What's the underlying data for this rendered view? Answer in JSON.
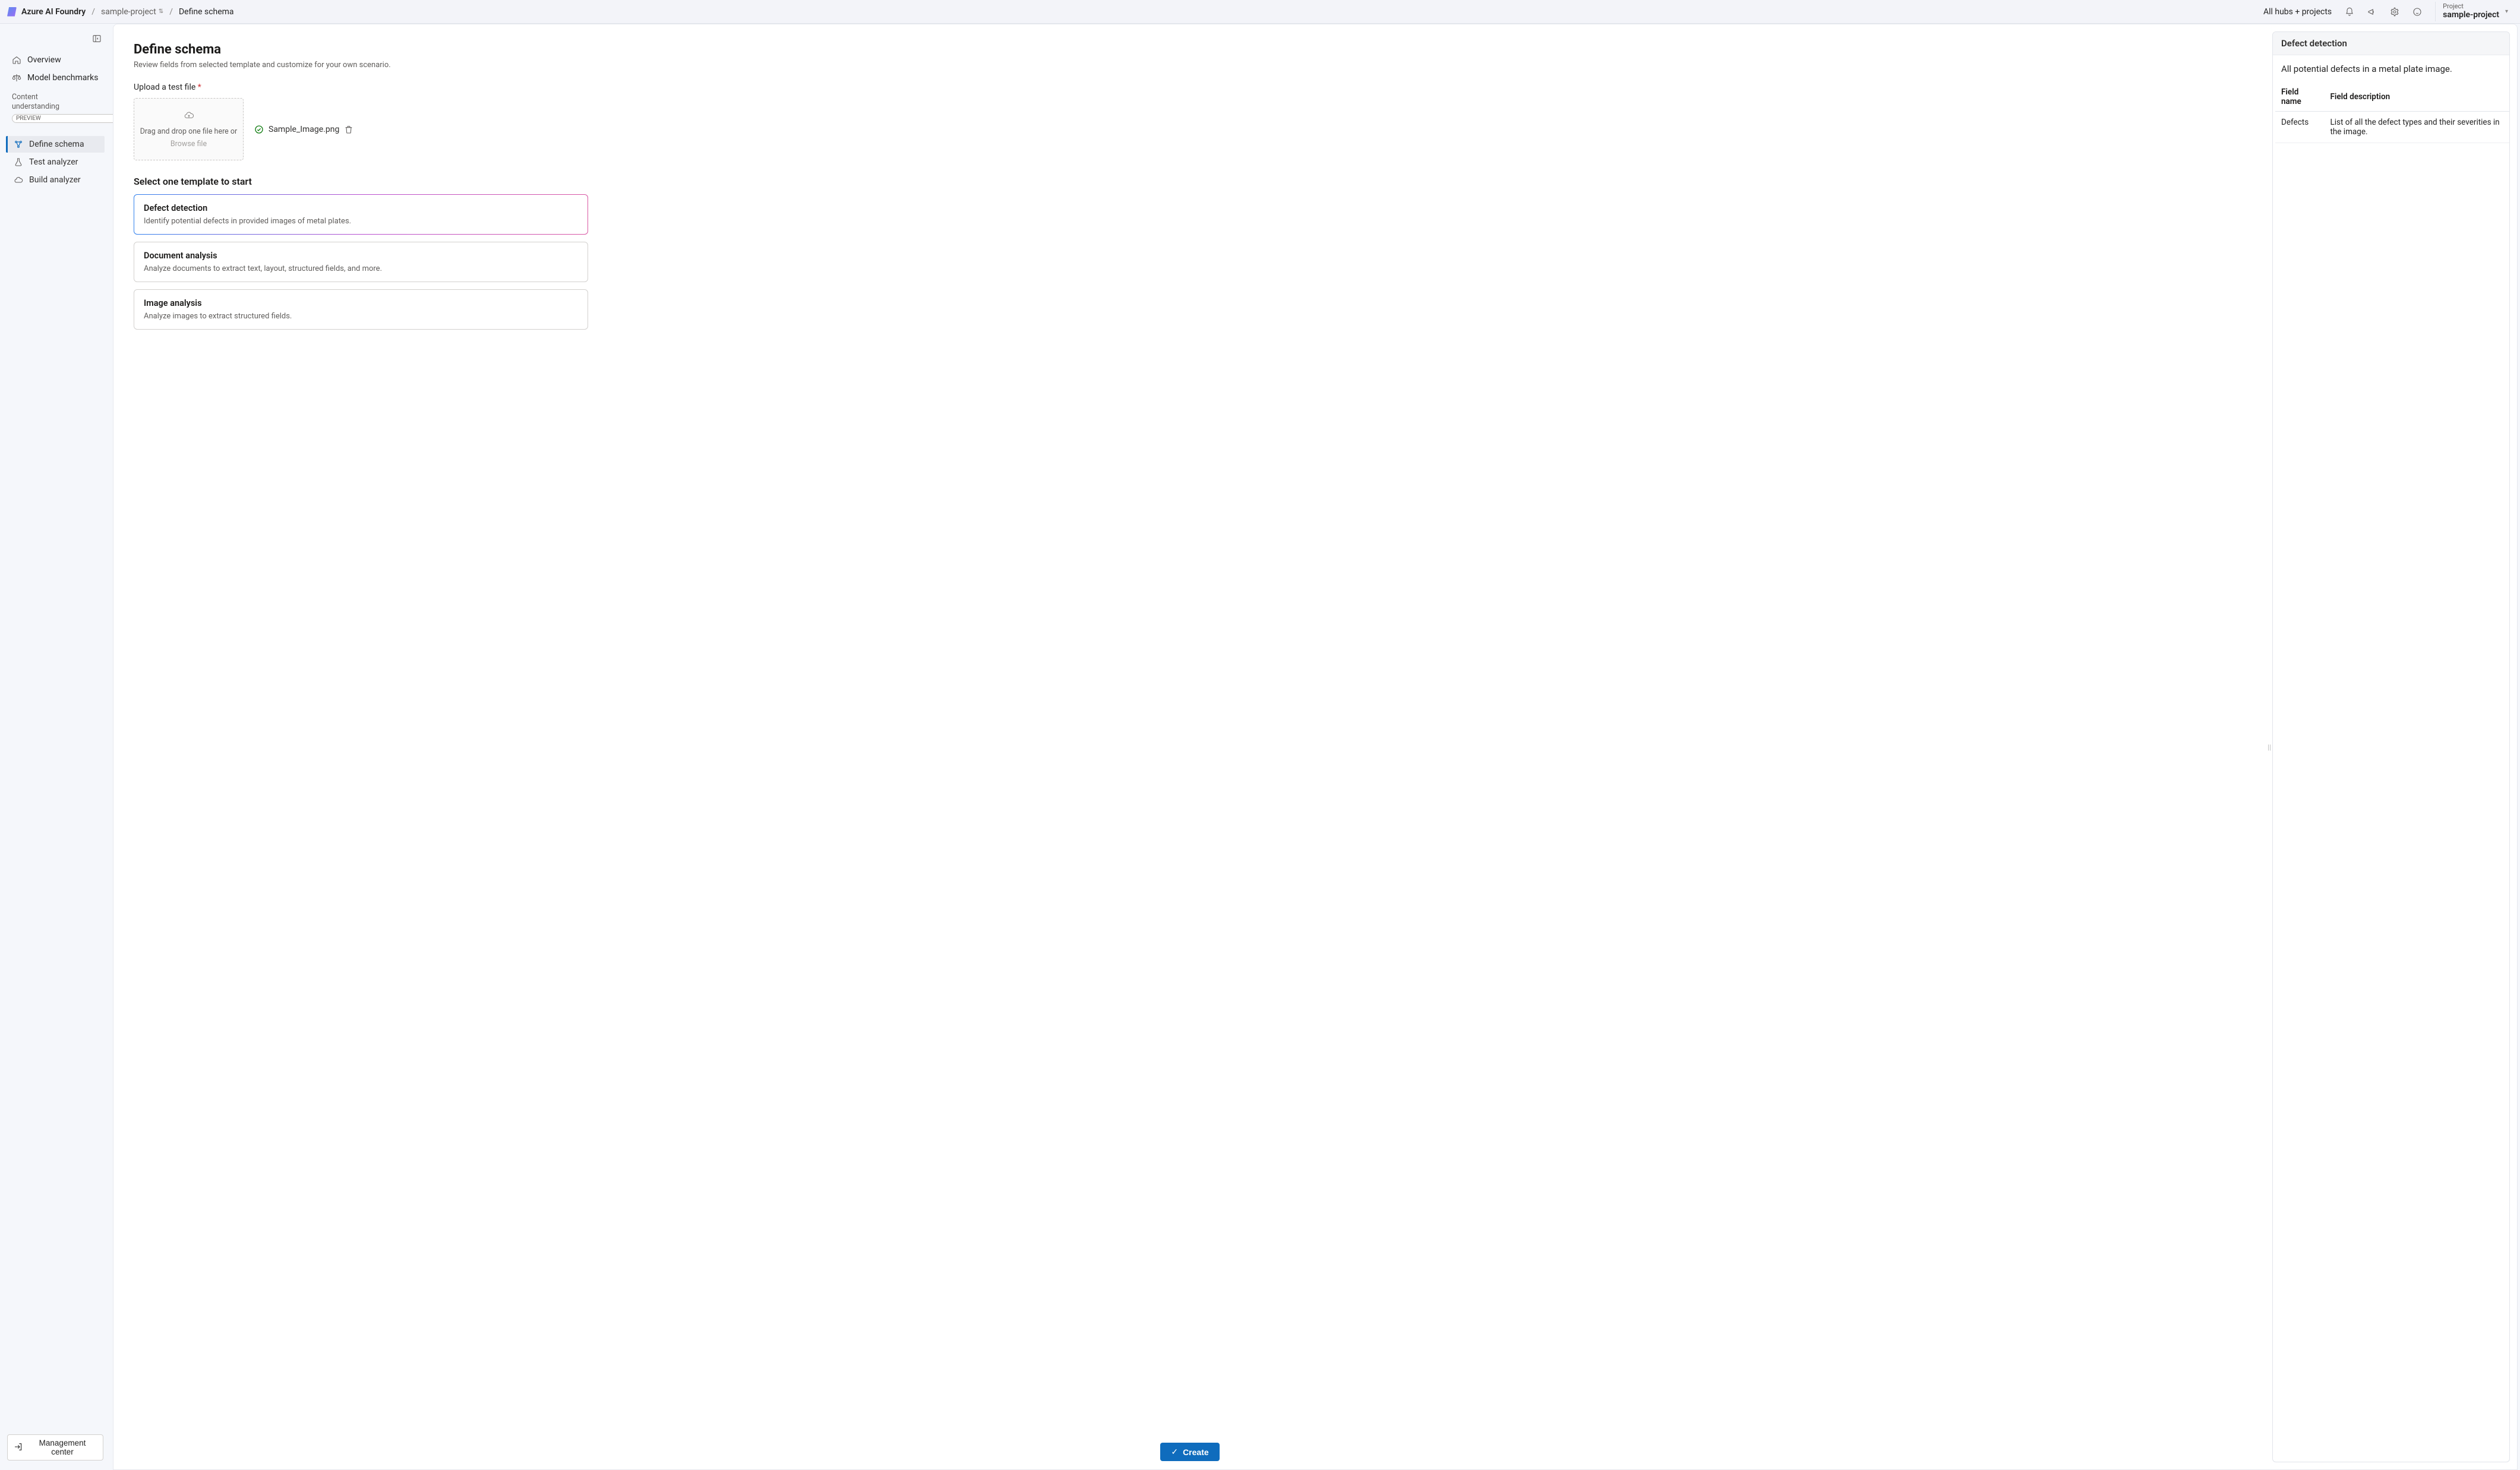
{
  "header": {
    "brand": "Azure AI Foundry",
    "breadcrumb_project": "sample-project",
    "breadcrumb_page": "Define schema",
    "all_hubs_label": "All hubs + projects",
    "project_label": "Project",
    "project_value": "sample-project"
  },
  "sidebar": {
    "overview": "Overview",
    "benchmarks": "Model benchmarks",
    "group_title_line1": "Content",
    "group_title_line2": "understanding",
    "group_preview": "PREVIEW",
    "define_schema": "Define schema",
    "test_analyzer": "Test analyzer",
    "build_analyzer": "Build analyzer",
    "management_center": "Management center"
  },
  "page": {
    "title": "Define schema",
    "subtitle": "Review fields from selected template and customize for your own scenario.",
    "upload_label": "Upload a test file",
    "dropzone_line1": "Drag and drop one file here or",
    "dropzone_browse": "Browse file",
    "uploaded_file": "Sample_Image.png",
    "templates_heading": "Select one template to start",
    "create_label": "Create"
  },
  "templates": [
    {
      "title": "Defect detection",
      "desc": "Identify potential defects in provided images of metal plates.",
      "selected": true
    },
    {
      "title": "Document analysis",
      "desc": "Analyze documents to extract text, layout, structured fields, and more.",
      "selected": false
    },
    {
      "title": "Image analysis",
      "desc": "Analyze images to extract structured fields.",
      "selected": false
    }
  ],
  "preview": {
    "title": "Defect detection",
    "description": "All potential defects in a metal plate image.",
    "col_name": "Field name",
    "col_desc": "Field description",
    "rows": [
      {
        "name": "Defects",
        "desc": "List of all the defect types and their severities in the image."
      }
    ]
  }
}
